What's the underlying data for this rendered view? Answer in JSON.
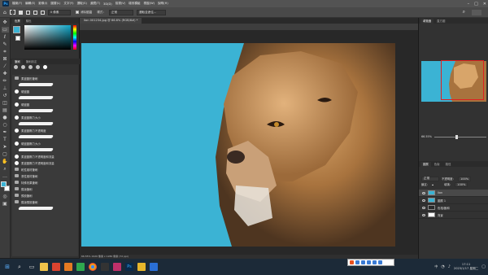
{
  "menubar": {
    "app_badge": "Ps",
    "items": [
      "檔案(F)",
      "編輯(E)",
      "影像(I)",
      "圖層(L)",
      "文字(Y)",
      "選取(S)",
      "濾鏡(T)",
      "3D(D)",
      "檢視(V)",
      "增效模組",
      "視窗(W)",
      "說明(H)"
    ],
    "window_controls": [
      "–",
      "□",
      "✕"
    ]
  },
  "options": {
    "mode_value": "0 像素",
    "anti_alias": "消除鋸齒",
    "style": "樣式：",
    "style_value": "正常",
    "select_and_mask": "選取並遮住..."
  },
  "doc_tab": "lion 001234.jpg @ 66.6% (RGB/8#) *",
  "left_panel": {
    "tabs": [
      "色票",
      "顏色"
    ],
    "tabs2": [
      "筆刷",
      "筆刷設定"
    ],
    "presets": [
      {
        "kind": "folder",
        "label": "柔邊圓形筆刷"
      },
      {
        "kind": "stroke",
        "label": ""
      },
      {
        "kind": "item",
        "label": "硬邊圓"
      },
      {
        "kind": "stroke",
        "label": ""
      },
      {
        "kind": "item",
        "label": "硬邊圓"
      },
      {
        "kind": "stroke",
        "label": ""
      },
      {
        "kind": "item",
        "label": "柔邊圓壓力大小"
      },
      {
        "kind": "stroke",
        "label": ""
      },
      {
        "kind": "item",
        "label": "柔邊圓壓力不透明度"
      },
      {
        "kind": "stroke",
        "label": ""
      },
      {
        "kind": "item",
        "label": "硬邊圓壓力大小"
      },
      {
        "kind": "stroke",
        "label": ""
      },
      {
        "kind": "item",
        "label": "柔邊圓壓力不透明度和流量"
      },
      {
        "kind": "item",
        "label": "柔邊圓壓力不透明度和流量"
      },
      {
        "kind": "folder",
        "label": "乾性媒材筆刷"
      },
      {
        "kind": "folder",
        "label": "濕性媒材筆刷"
      },
      {
        "kind": "folder",
        "label": "特殊效果筆刷"
      },
      {
        "kind": "folder",
        "label": "舊版筆刷"
      },
      {
        "kind": "folder",
        "label": "預設筆刷"
      },
      {
        "kind": "folder",
        "label": "舊版預設筆刷"
      },
      {
        "kind": "stroke",
        "label": ""
      }
    ]
  },
  "status": "66.55%  1920 像素 x 1280 像素 (72 ppi)",
  "right_panel": {
    "tabs": [
      "導覽器",
      "直方圖"
    ],
    "zoom": "66.55%",
    "layers_tabs": [
      "圖層",
      "色版",
      "路徑"
    ],
    "blend_label": "正常",
    "opacity_label": "不透明度：",
    "opacity_value": "100%",
    "lock_label": "鎖定：",
    "fill_label": "填滿：",
    "fill_value": "100%",
    "layers": [
      {
        "name": "lion",
        "selected": true,
        "thumb": "#3bb3d4"
      },
      {
        "name": "圖層 1",
        "selected": false,
        "thumb": "#3bb3d4"
      },
      {
        "name": "色相/飽和",
        "selected": false,
        "thumb": "#2a2a2a"
      },
      {
        "name": "背景",
        "selected": false,
        "thumb": "#ffffff"
      }
    ]
  },
  "taskbar": {
    "clock_time": "17:11",
    "clock_date": "2023/1/17 星期二",
    "tray_lang": "中"
  },
  "colors": {
    "canvas_bg": "#3bb3d4",
    "fg": "#3bb3d4",
    "bg": "#ffffff"
  }
}
